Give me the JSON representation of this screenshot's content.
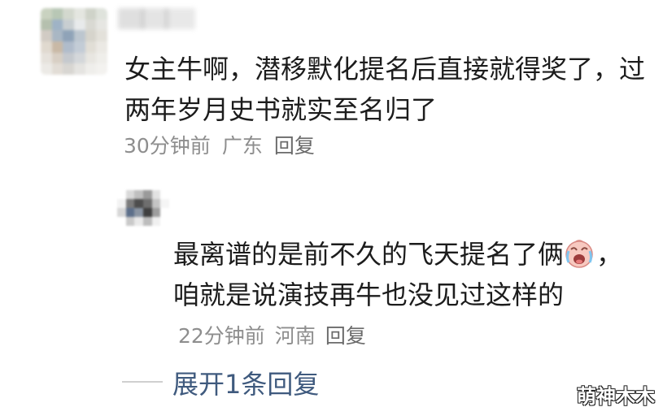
{
  "comment": {
    "avatar_icon": "blurred-avatar",
    "text": "女主牛啊，潜移默化提名后直接就得奖了，过两年岁月史书就实至名归了",
    "time": "30分钟前",
    "location": "广东",
    "reply_label": "回复"
  },
  "reply": {
    "avatar_icon": "blurred-avatar",
    "text_before_emoji": "最离谱的是前不久的飞天提名了俩",
    "emoji": "crying-laughing-face-icon",
    "text_after_emoji": "，咱就是说演技再牛也没见过这样的",
    "time": "22分钟前",
    "location": "河南",
    "reply_label": "回复"
  },
  "expand_label": "展开1条回复",
  "watermark": "萌神木木",
  "colors": {
    "text": "#1c1c1c",
    "meta": "#8e8e8e",
    "link": "#3f5a7e",
    "divider": "#d0d0d0"
  }
}
